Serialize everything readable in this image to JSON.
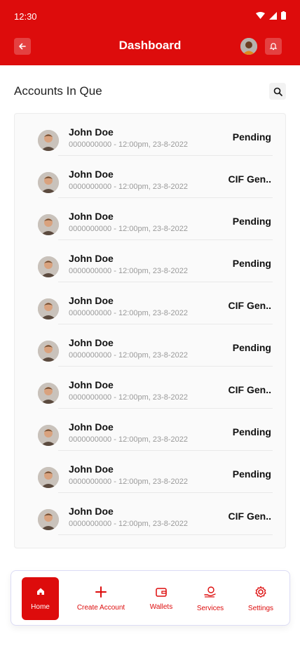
{
  "status_bar": {
    "time": "12:30"
  },
  "header": {
    "title": "Dashboard"
  },
  "section": {
    "title": "Accounts In Que"
  },
  "accounts": [
    {
      "name": "John Doe",
      "meta": "0000000000 - 12:00pm, 23-8-2022",
      "status": "Pending"
    },
    {
      "name": "John Doe",
      "meta": "0000000000 - 12:00pm, 23-8-2022",
      "status": "CIF Gen.."
    },
    {
      "name": "John Doe",
      "meta": "0000000000 - 12:00pm, 23-8-2022",
      "status": "Pending"
    },
    {
      "name": "John Doe",
      "meta": "0000000000 - 12:00pm, 23-8-2022",
      "status": "Pending"
    },
    {
      "name": "John Doe",
      "meta": "0000000000 - 12:00pm, 23-8-2022",
      "status": "CIF Gen.."
    },
    {
      "name": "John Doe",
      "meta": "0000000000 - 12:00pm, 23-8-2022",
      "status": "Pending"
    },
    {
      "name": "John Doe",
      "meta": "0000000000 - 12:00pm, 23-8-2022",
      "status": "CIF Gen.."
    },
    {
      "name": "John Doe",
      "meta": "0000000000 - 12:00pm, 23-8-2022",
      "status": "Pending"
    },
    {
      "name": "John Doe",
      "meta": "0000000000 - 12:00pm, 23-8-2022",
      "status": "Pending"
    },
    {
      "name": "John Doe",
      "meta": "0000000000 - 12:00pm, 23-8-2022",
      "status": "CIF Gen.."
    }
  ],
  "nav": {
    "home": "Home",
    "create_account": "Create Account",
    "wallets": "Wallets",
    "services": "Services",
    "settings": "Settings"
  },
  "colors": {
    "brand": "#dd0c0c",
    "text": "#111111",
    "muted": "#9a9a9a"
  }
}
